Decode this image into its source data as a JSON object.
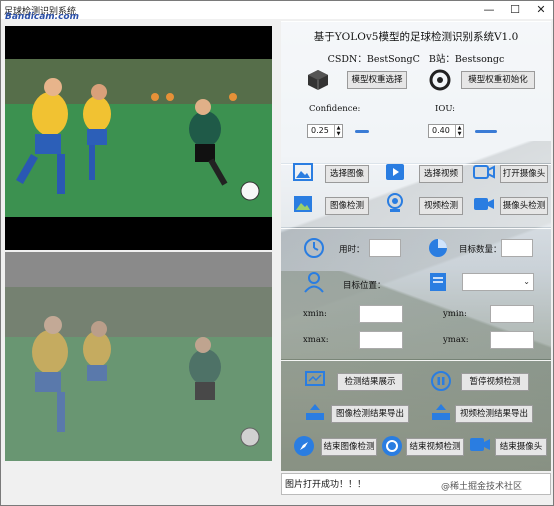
{
  "window": {
    "title": "足球检测识别系统",
    "watermark": "Bandicam.com"
  },
  "header": {
    "title": "基于YOLOv5模型的足球检测识别系统V1.0",
    "csdn": "CSDN：BestSongC",
    "bilibili": "B站：Bestsongc"
  },
  "weights": {
    "select_label": "模型权重选择",
    "init_label": "模型权重初始化"
  },
  "params": {
    "confidence_label": "Confidence:",
    "confidence_value": "0.25",
    "iou_label": "IOU:",
    "iou_value": "0.40"
  },
  "media_buttons": {
    "select_image": "选择图像",
    "select_video": "选择视频",
    "open_camera": "打开摄像头",
    "image_detect": "图像检测",
    "video_detect": "视频检测",
    "camera_detect": "摄像头检测"
  },
  "stats": {
    "time_label": "用时：",
    "time_value": "",
    "count_label": "目标数量：",
    "count_value": "",
    "position_label": "目标位置：",
    "xmin_label": "xmin:",
    "ymin_label": "ymin:",
    "xmax_label": "xmax:",
    "ymax_label": "ymax:"
  },
  "result_buttons": {
    "show_result": "检测结果展示",
    "pause_video": "暂停视频检测",
    "export_image": "图像检测结果导出",
    "export_video": "视频检测结果导出",
    "end_image": "结束图像检测",
    "end_video": "结束视频检测",
    "close_camera": "结束摄像头"
  },
  "status": {
    "message": "图片打开成功！！！"
  },
  "footer_watermark": "@稀土掘金技术社区",
  "colors": {
    "accent_blue": "#2a7de1",
    "slider_blue": "#3a7bd5"
  }
}
